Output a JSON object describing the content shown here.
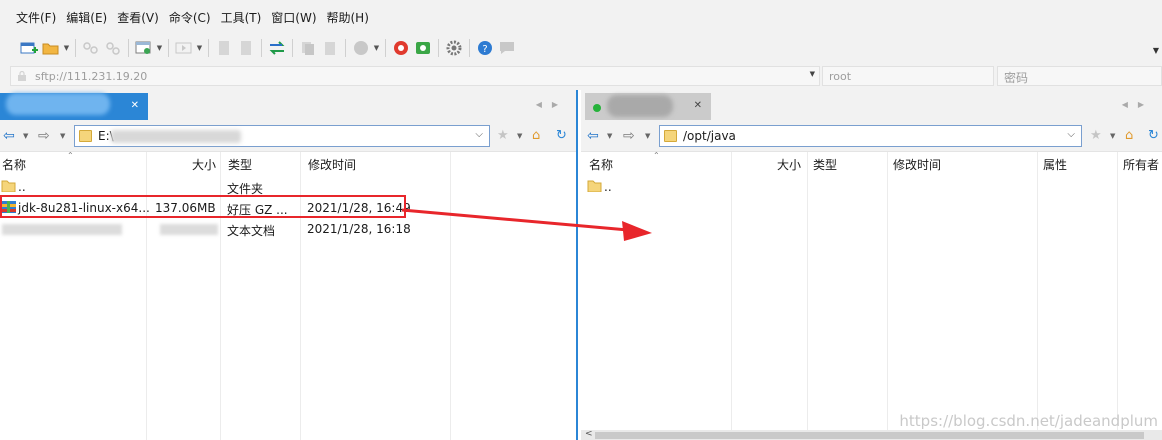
{
  "menu": [
    "文件(F)",
    "编辑(E)",
    "查看(V)",
    "命令(C)",
    "工具(T)",
    "窗口(W)",
    "帮助(H)"
  ],
  "address": {
    "host": "sftp://111.231.19.20",
    "user_placeholder": "root",
    "pass_placeholder": "密码"
  },
  "left_pane": {
    "path": "E:\\",
    "columns": [
      "名称",
      "大小",
      "类型",
      "修改时间"
    ],
    "rows": [
      {
        "name": "..",
        "size": "",
        "type": "文件夹",
        "modified": ""
      },
      {
        "name": "jdk-8u281-linux-x64...",
        "size": "137.06MB",
        "type": "好压 GZ ...",
        "modified": "2021/1/28, 16:49"
      },
      {
        "name": "",
        "size": "",
        "type": "文本文档",
        "modified": "2021/1/28, 16:18"
      }
    ]
  },
  "right_pane": {
    "path": "/opt/java",
    "columns": [
      "名称",
      "大小",
      "类型",
      "修改时间",
      "属性",
      "所有者"
    ],
    "rows": [
      {
        "name": ".."
      }
    ]
  },
  "watermark": "https://blog.csdn.net/jadeandplum",
  "colors": {
    "accent": "#2b86d6",
    "highlight_box": "#e8262b",
    "arrow": "#e8262b",
    "tab_inactive": "#cbcbcb",
    "chrome": "#f2f2f2"
  }
}
